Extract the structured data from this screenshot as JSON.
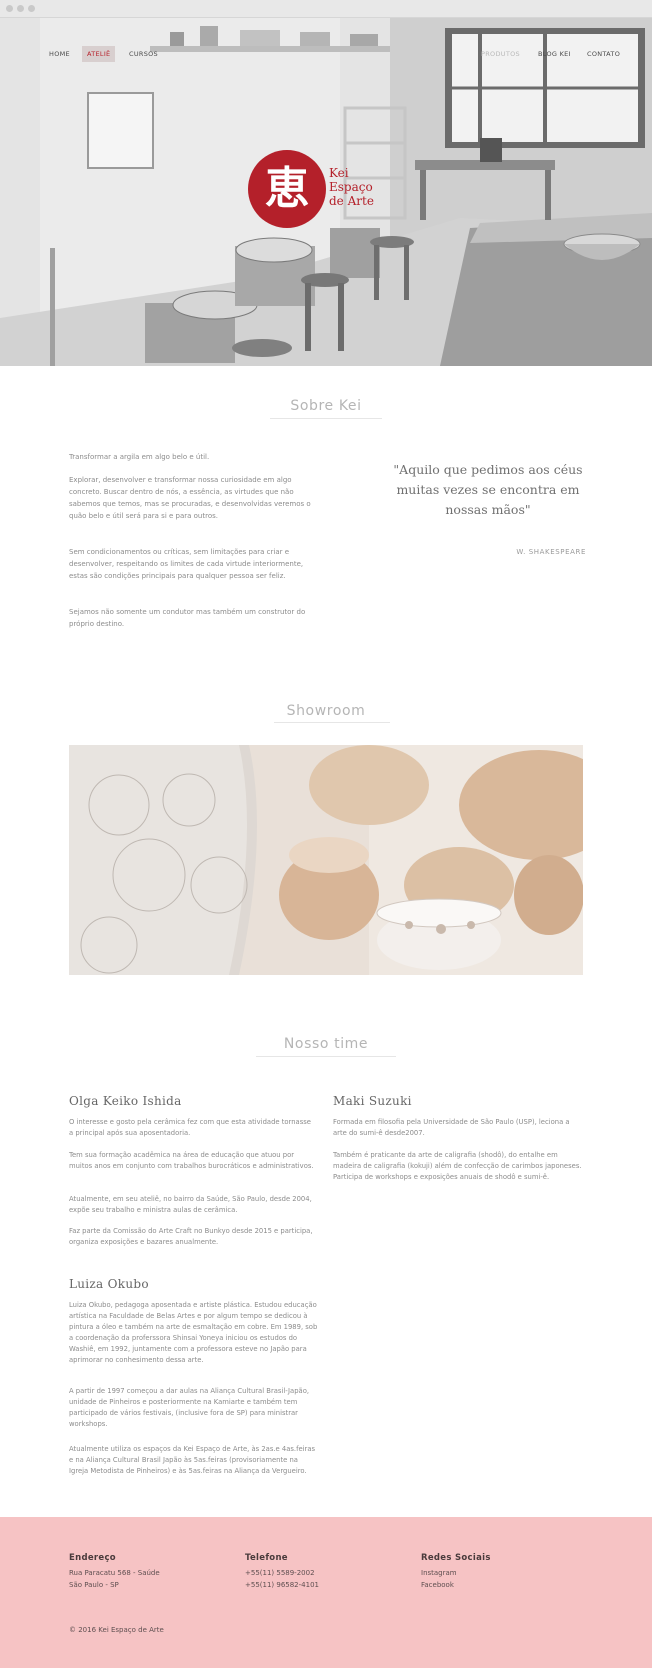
{
  "nav": {
    "left": [
      "HOME",
      "ATELIÊ",
      "CURSOS"
    ],
    "right": [
      "PRODUTOS",
      "BLOG KEI",
      "CONTATO"
    ],
    "active": "ATELIÊ"
  },
  "logo": {
    "glyph": "恵",
    "lines": [
      "Kei",
      "Espaço",
      "de Arte"
    ],
    "color": "#b4202a"
  },
  "about": {
    "title": "Sobre Kei",
    "paragraphs": [
      "Transformar a argila em algo belo e útil.",
      "Explorar, desenvolver e transformar nossa curiosidade em algo concreto. Buscar dentro de nós, a essência, as virtudes que não sabemos que temos, mas se procuradas, e desenvolvidas veremos o quão belo e útil será para si e para outros.",
      "Sem condicionamentos ou críticas, sem limitações para criar e desenvolver, respeitando os limites de cada virtude interiormente, estas são condições principais para qualquer pessoa ser feliz.",
      "Sejamos não somente um condutor mas também um construtor do próprio destino."
    ],
    "quote": "\"Aquilo que pedimos aos céus muitas vezes se encontra em nossas mãos\"",
    "quote_author": "W. SHAKESPEARE"
  },
  "showroom": {
    "title": "Showroom"
  },
  "team": {
    "title": "Nosso time",
    "members": [
      {
        "name": "Olga Keiko Ishida",
        "paragraphs": [
          "O interesse e gosto pela cerâmica fez com que esta atividade tornasse a principal após sua aposentadoria.",
          "Tem sua formação acadêmica na área de educação que atuou por muitos anos em conjunto com trabalhos burocráticos e administrativos.",
          "Atualmente, em seu ateliê, no bairro da Saúde, São Paulo, desde 2004, expõe seu trabalho e ministra aulas de cerâmica.",
          "Faz parte da Comissão do Arte Craft no Bunkyo desde 2015 e participa, organiza exposições e bazares anualmente."
        ]
      },
      {
        "name": "Maki Suzuki",
        "paragraphs": [
          "Formada em filosofia pela Universidade de São Paulo (USP), leciona a arte do sumi-ê desde2007.",
          "Também é praticante da arte de caligrafia (shodô), do entalhe em madeira de caligrafia (kokuji) além de confecção de carimbos japoneses. Participa de workshops e exposições anuais de shodô e sumi-ê."
        ]
      },
      {
        "name": "Luiza Okubo",
        "paragraphs": [
          "Luiza Okubo, pedagoga aposentada e artiste plástica. Estudou educação artística na Faculdade de Belas Artes e por algum tempo se dedicou à pintura a óleo e também na arte de esmaltação em cobre. Em 1989, sob a coordenação da proferssora Shinsai Yoneya iniciou os estudos do Washiê, em 1992, juntamente com a professora esteve no Japão para aprimorar no conhesimento dessa arte.",
          "A partir de 1997 começou a dar aulas na Aliança Cultural Brasil-Japão, unidade de Pinheiros e posteriormente na Kamiarte e também tem participado de vários festivais, (inclusive fora de SP) para ministrar workshops.",
          "Atualmente utiliza os espaços da Kei Espaço de Arte, às 2as.e 4as.feiras e na Aliança Cultural Brasil Japão às 5as.feiras (provisoriamente na Igreja Metodista de Pinheiros) e às 5as.feiras na Aliança da Vergueiro."
        ]
      }
    ]
  },
  "footer": {
    "address_title": "Endereço",
    "address": [
      "Rua Paracatu 568 - Saúde",
      "São Paulo - SP"
    ],
    "phone_title": "Telefone",
    "phones": [
      "+55(11) 5589-2002",
      "+55(11) 96582-4101"
    ],
    "social_title": "Redes Sociais",
    "social": [
      "Instagram",
      "Facebook"
    ],
    "copyright": "© 2016 Kei Espaço de Arte",
    "background": "#f6c3c4"
  }
}
